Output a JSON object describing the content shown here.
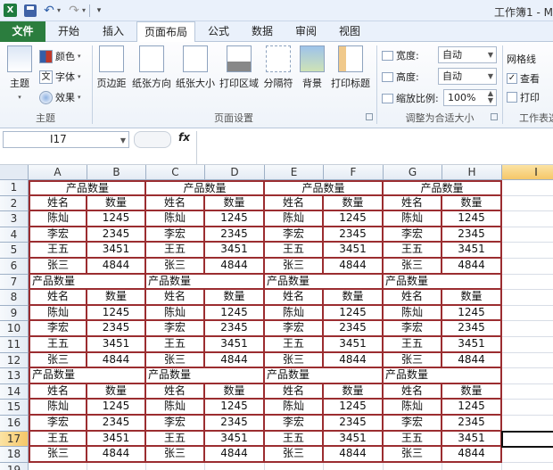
{
  "qat": {
    "excel_icon": "X",
    "save_icon": "save-icon",
    "undo_icon": "undo-icon",
    "redo_icon": "redo-icon"
  },
  "title": "工作簿1 - M",
  "tabs": {
    "file": "文件",
    "home": "开始",
    "insert": "插入",
    "layout": "页面布局",
    "formulas": "公式",
    "data": "数据",
    "review": "审阅",
    "view": "视图"
  },
  "ribbon": {
    "theme": {
      "themes": "主题",
      "colors": "颜色",
      "fonts": "字体",
      "effects": "效果",
      "group": "主题"
    },
    "page_setup": {
      "margins": "页边距",
      "orientation": "纸张方向",
      "size": "纸张大小",
      "print_area": "打印区域",
      "breaks": "分隔符",
      "background": "背景",
      "print_titles": "打印标题",
      "group": "页面设置"
    },
    "scale": {
      "width_label": "宽度:",
      "width_value": "自动",
      "height_label": "高度:",
      "height_value": "自动",
      "scale_label": "缩放比例:",
      "scale_value": "100%",
      "group": "调整为合适大小"
    },
    "sheet_opts": {
      "gridlines": "网格线",
      "view": "查看",
      "print": "打印",
      "group": "工作表选"
    }
  },
  "formula_bar": {
    "name_box": "I17",
    "fx": "fx",
    "content": ""
  },
  "columns": [
    "A",
    "B",
    "C",
    "D",
    "E",
    "F",
    "G",
    "H",
    "I"
  ],
  "selected_col": "I",
  "selected_row": "17",
  "rows": [
    "1",
    "2",
    "3",
    "4",
    "5",
    "6",
    "7",
    "8",
    "9",
    "10",
    "11",
    "12",
    "13",
    "14",
    "15",
    "16",
    "17",
    "18",
    "19"
  ],
  "table": {
    "title": "产品数量",
    "header": [
      "姓名",
      "数量"
    ],
    "records": [
      [
        "陈灿",
        "1245"
      ],
      [
        "李宏",
        "2345"
      ],
      [
        "王五",
        "3451"
      ],
      [
        "张三",
        "4844"
      ]
    ]
  }
}
